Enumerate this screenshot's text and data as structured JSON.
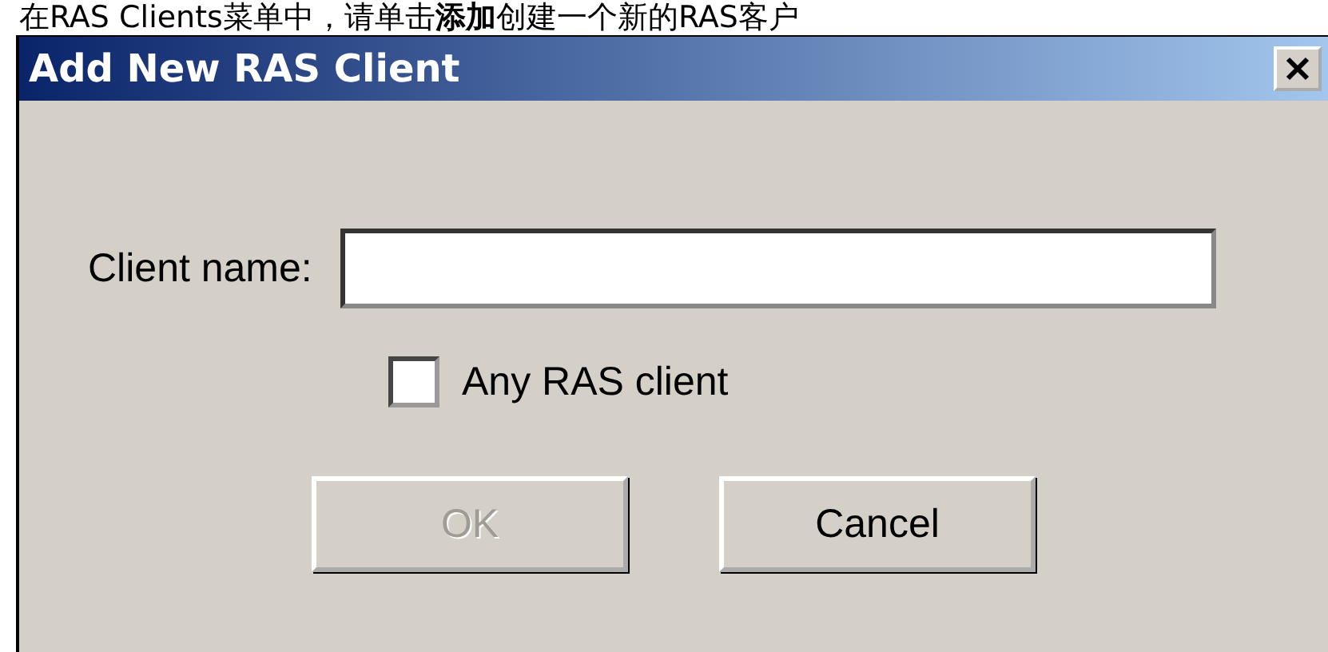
{
  "caption": "在RAS Clients菜单中，请单击**添加**创建一个新的RAS客户",
  "window": {
    "title": "Add New RAS Client"
  },
  "form": {
    "label": "Client name:"
  },
  "checkbox": {
    "label": "Any RAS client",
    "checked": false
  },
  "buttons": [
    {
      "label": "OK",
      "disabled": true
    },
    {
      "label": "Cancel",
      "disabled": false
    }
  ]
}
